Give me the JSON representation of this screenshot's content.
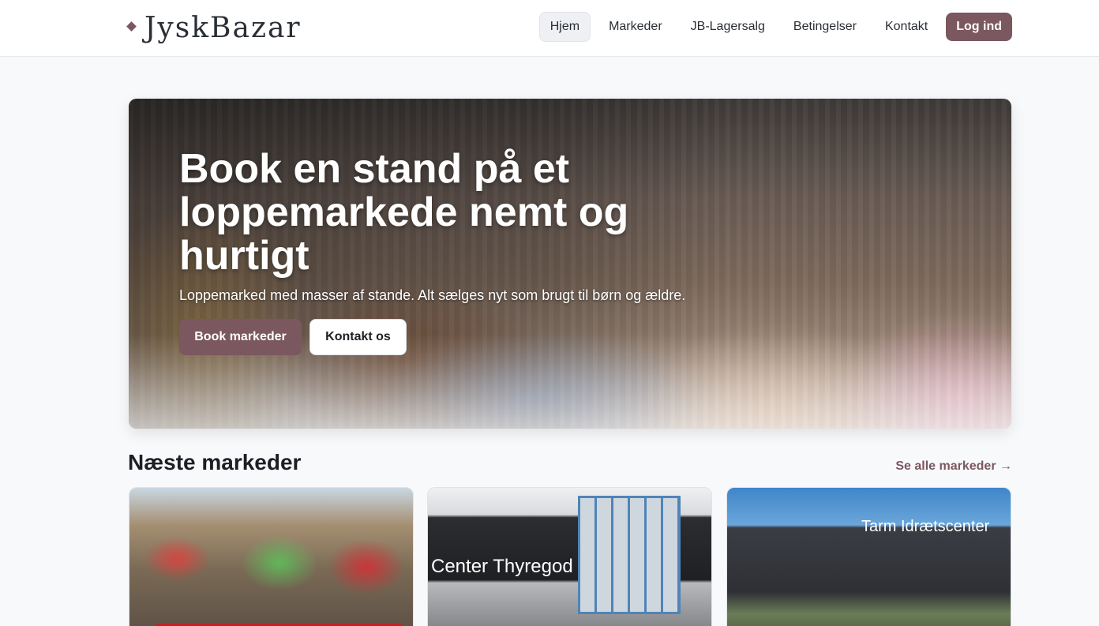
{
  "header": {
    "brand": "JyskBazar",
    "nav": [
      {
        "label": "Hjem",
        "active": true
      },
      {
        "label": "Markeder",
        "active": false
      },
      {
        "label": "JB-Lagersalg",
        "active": false
      },
      {
        "label": "Betingelser",
        "active": false
      },
      {
        "label": "Kontakt",
        "active": false
      }
    ],
    "login_label": "Log ind"
  },
  "hero": {
    "title": "Book en stand på et loppemarkede nemt og hurtigt",
    "subtitle": "Loppemarked med masser af stande. Alt sælges nyt som brugt til børn og ældre.",
    "primary_button": "Book markeder",
    "secondary_button": "Kontakt os"
  },
  "section": {
    "title": "Næste markeder",
    "see_all": "Se alle markeder →"
  },
  "cards": [
    {
      "image": "festival-crowd-image"
    },
    {
      "image": "center-thyregod-image",
      "sign_text": "Center Thyregod"
    },
    {
      "image": "tarm-idraetscenter-image",
      "sign_text": "Tarm Idrætscenter"
    }
  ],
  "colors": {
    "accent": "#7b5760",
    "background": "#f8f9fb",
    "text": "#1b1f24"
  }
}
